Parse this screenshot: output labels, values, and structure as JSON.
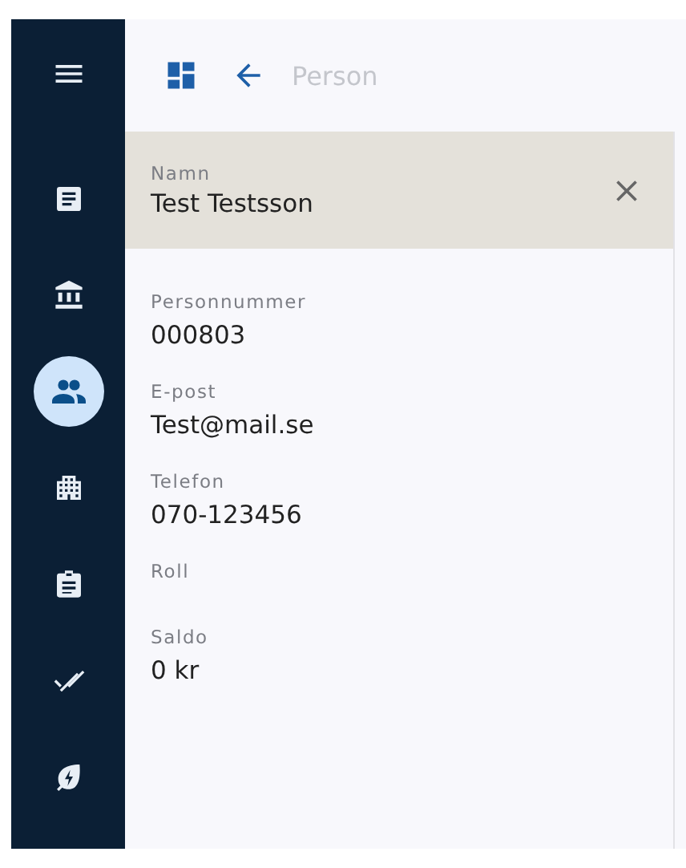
{
  "sidebar": {
    "items": [
      {
        "kind": "document",
        "selected": false
      },
      {
        "kind": "bank",
        "selected": false
      },
      {
        "kind": "people",
        "selected": true
      },
      {
        "kind": "building",
        "selected": false
      },
      {
        "kind": "clipboard",
        "selected": false
      },
      {
        "kind": "done-all",
        "selected": false
      },
      {
        "kind": "eco",
        "selected": false
      }
    ]
  },
  "header": {
    "title": "Person"
  },
  "name_field": {
    "label": "Namn",
    "value": "Test Testsson"
  },
  "fields": [
    {
      "label": "Personnummer",
      "value": "000803"
    },
    {
      "label": "E-post",
      "value": "Test@mail.se"
    },
    {
      "label": "Telefon",
      "value": "070-123456"
    },
    {
      "label": "Roll"
    },
    {
      "label": "Saldo",
      "value": "0 kr"
    }
  ]
}
